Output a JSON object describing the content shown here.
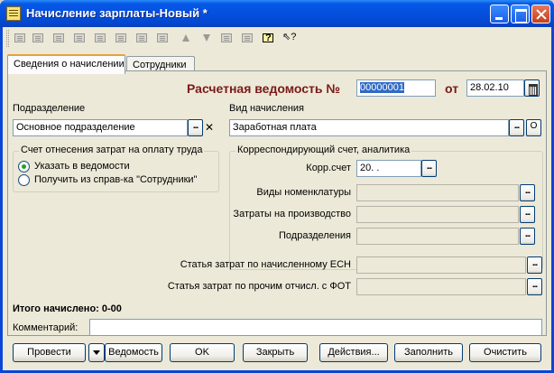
{
  "window": {
    "title": "Начисление зарплаты-Новый *"
  },
  "tabs": [
    {
      "label": "Сведения о начислении",
      "active": true
    },
    {
      "label": "Сотрудники",
      "active": false
    }
  ],
  "header": {
    "doc_label": "Расчетная ведомость №",
    "doc_number": "00000001",
    "date_label": "от",
    "date": "28.02.10"
  },
  "department": {
    "label": "Подразделение",
    "value": "Основное подразделение"
  },
  "accrual_type": {
    "label": "Вид начисления",
    "value": "Заработная плата"
  },
  "cost_account": {
    "title": "Счет отнесения затрат на оплату труда",
    "options": [
      {
        "label": "Указать в ведомости",
        "selected": true
      },
      {
        "label": "Получить из справ-ка \"Сотрудники\"",
        "selected": false
      }
    ]
  },
  "corr_account": {
    "title": "Корреспондирующий счет, аналитика",
    "fields": [
      {
        "label": "Корр.счет",
        "value": "20. ."
      },
      {
        "label": "Виды номенклатуры",
        "value": ""
      },
      {
        "label": "Затраты на производство",
        "value": ""
      },
      {
        "label": "Подразделения",
        "value": ""
      }
    ]
  },
  "expense_items": [
    {
      "label": "Статья затрат по начисленному ЕСН",
      "value": ""
    },
    {
      "label": "Статья затрат по прочим отчисл. с ФОТ",
      "value": ""
    }
  ],
  "total": {
    "label": "Итого начислено: 0-00"
  },
  "comment": {
    "label": "Комментарий:",
    "value": ""
  },
  "buttons": {
    "post": "Провести",
    "statement": "Ведомость",
    "ok": "OK",
    "close": "Закрыть",
    "actions": "Действия...",
    "fill": "Заполнить",
    "clear": "Очистить"
  },
  "toolbar_icons": [
    "add-row-icon",
    "copy-row-icon",
    "edit-row-icon",
    "delete-row-icon",
    "end-edit-icon",
    "mark-delete-icon",
    "move-up-icon",
    "move-down-icon",
    "sort-asc-icon",
    "sort-desc-icon",
    "help-icon",
    "context-help-icon"
  ]
}
